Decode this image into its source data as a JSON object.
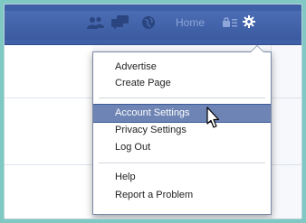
{
  "topbar": {
    "home_label": "Home",
    "icons": [
      "friends-icon",
      "messages-icon",
      "notifications-icon",
      "privacy-shortcuts-icon",
      "settings-gear-icon"
    ]
  },
  "menu": {
    "group1": [
      "Advertise",
      "Create Page"
    ],
    "group2": [
      "Account Settings",
      "Privacy Settings",
      "Log Out"
    ],
    "group3": [
      "Help",
      "Report a Problem"
    ],
    "active_item": "Account Settings"
  },
  "colors": {
    "topbar": "#3f5fa6",
    "highlight": "#6d84b4",
    "background": "#7fc8c4"
  }
}
